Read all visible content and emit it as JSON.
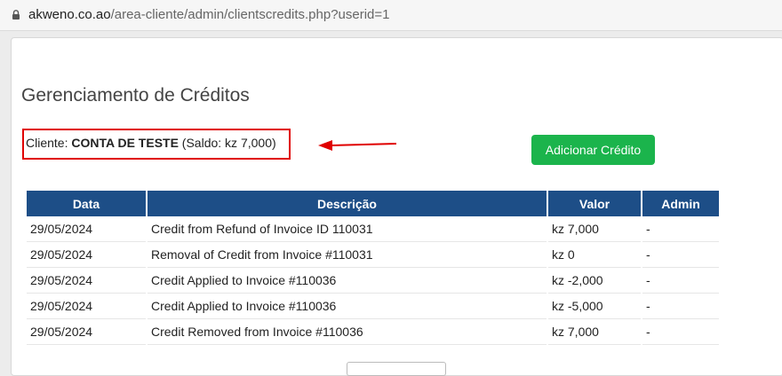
{
  "browser": {
    "domain": "akweno.co.ao",
    "path": "/area-cliente/admin/clientscredits.php?userid=1"
  },
  "page": {
    "title": "Gerenciamento de Créditos"
  },
  "client": {
    "prefix": "Cliente: ",
    "name": "CONTA DE TESTE",
    "balance": " (Saldo: kz 7,000)"
  },
  "actions": {
    "add_credit": "Adicionar Crédito"
  },
  "table": {
    "headers": {
      "date": "Data",
      "description": "Descrição",
      "value": "Valor",
      "admin": "Admin"
    },
    "rows": [
      {
        "date": "29/05/2024",
        "description": "Credit from Refund of Invoice ID 110031",
        "value": "kz 7,000",
        "admin": "-"
      },
      {
        "date": "29/05/2024",
        "description": "Removal of Credit from Invoice #110031",
        "value": "kz 0",
        "admin": "-"
      },
      {
        "date": "29/05/2024",
        "description": "Credit Applied to Invoice #110036",
        "value": "kz -2,000",
        "admin": "-"
      },
      {
        "date": "29/05/2024",
        "description": "Credit Applied to Invoice #110036",
        "value": "kz -5,000",
        "admin": "-"
      },
      {
        "date": "29/05/2024",
        "description": "Credit Removed from Invoice #110036",
        "value": "kz 7,000",
        "admin": "-"
      }
    ]
  },
  "colors": {
    "header_blue": "#1d4e87",
    "button_green": "#1bb44c",
    "highlight_red": "#e00000"
  }
}
